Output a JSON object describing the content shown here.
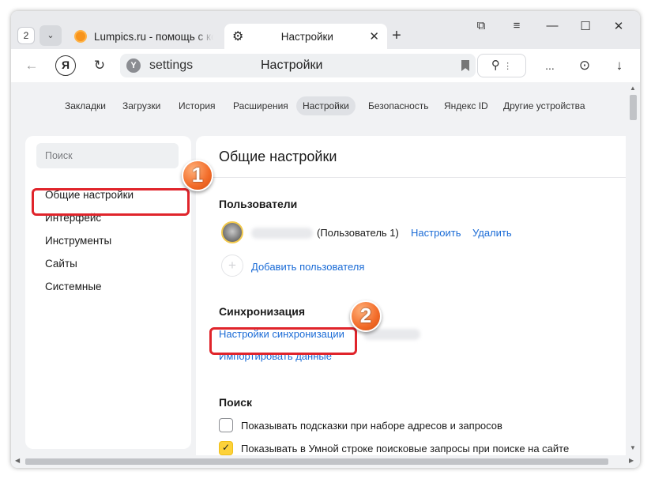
{
  "tabstrip": {
    "tab_count": "2",
    "tabs": [
      {
        "title": "Lumpics.ru - помощь с ком",
        "icon": "orange-favicon"
      },
      {
        "title": "Настройки",
        "icon": "gear-icon",
        "close": "✕"
      }
    ],
    "new_tab": "+",
    "window_controls": {
      "bookmarks": "⧉",
      "menu": "≡",
      "minimize": "—",
      "maximize": "☐",
      "close": "✕"
    }
  },
  "toolbar": {
    "back": "←",
    "yandex": "Я",
    "reload": "↻",
    "address": "settings",
    "page_title": "Настройки",
    "sidebar_btn": "⊙",
    "more": "...",
    "download": "↓"
  },
  "nav": {
    "items": [
      "Закладки",
      "Загрузки",
      "История",
      "Расширения",
      "Настройки",
      "Безопасность",
      "Яндекс ID",
      "Другие устройства"
    ],
    "active": "Настройки"
  },
  "sidebar": {
    "search_placeholder": "Поиск",
    "items": [
      "Общие настройки",
      "Интерфейс",
      "Инструменты",
      "Сайты",
      "Системные"
    ]
  },
  "main": {
    "title": "Общие настройки",
    "users": {
      "heading": "Пользователи",
      "user_label": "(Пользователь 1)",
      "configure": "Настроить",
      "delete": "Удалить",
      "add_user": "Добавить пользователя"
    },
    "sync": {
      "heading": "Синхронизация",
      "settings_link": "Настройки синхронизации",
      "import_link": "Импортировать данные"
    },
    "search": {
      "heading": "Поиск",
      "options": [
        {
          "label": "Показывать подсказки при наборе адресов и запросов",
          "checked": false
        },
        {
          "label": "Показывать в Умной строке поисковые запросы при поиске на сайте",
          "checked": true
        }
      ]
    }
  },
  "annotations": {
    "badge1": "1",
    "badge2": "2",
    "highlight_color": "#e0242b",
    "badge_color": "#f26b28"
  },
  "colors": {
    "link": "#1a6bd6",
    "checkbox_checked": "#fdd23a"
  }
}
